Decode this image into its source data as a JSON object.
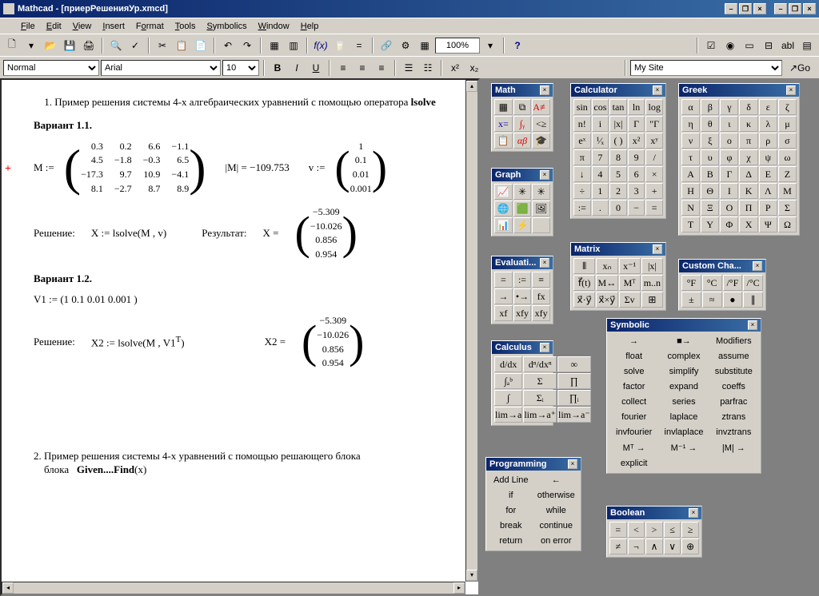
{
  "title": "Mathcad - [приерРешенияУр.xmcd]",
  "menu": [
    "File",
    "Edit",
    "View",
    "Insert",
    "Format",
    "Tools",
    "Symbolics",
    "Window",
    "Help"
  ],
  "toolbar": {
    "zoom": "100%",
    "style": "Normal",
    "font": "Arial",
    "size": "10",
    "site": "My Site",
    "go": "Go"
  },
  "doc": {
    "h1": "1.  Пример решения  системы 4-х алгебраических уравнений с помощью оператора  ",
    "lsolve": "lsolve",
    "var11": "Вариант 1.1.",
    "mlabel": "M :=",
    "m": [
      [
        "0.3",
        "0.2",
        "6.6",
        "−1.1"
      ],
      [
        "4.5",
        "−1.8",
        "−0.3",
        "6.5"
      ],
      [
        "−17.3",
        "9.7",
        "10.9",
        "−4.1"
      ],
      [
        "8.1",
        "−2.7",
        "8.7",
        "8.9"
      ]
    ],
    "det": "|M|  =  −109.753",
    "vlabel": "v :=",
    "v": [
      "1",
      "0.1",
      "0.01",
      "0.001"
    ],
    "resh": "Решение:",
    "xdef": "X := lsolve(M , v)",
    "result": "Результат:",
    "xeq": "X =",
    "X": [
      "−5.309",
      "−10.026",
      "0.856",
      "0.954"
    ],
    "var12": "Вариант 1.2.",
    "v1def": "V1 := (1   0.1   0.01   0.001 )",
    "x2def": "X2 := lsolve(M , V1",
    "t": "T",
    "x2eq": "X2 =",
    "X2": [
      "−5.309",
      "−10.026",
      "0.856",
      "0.954"
    ],
    "h2a": "2. Пример решения системы 4-х уравнений с помощью решающего блока   ",
    "h2b": "Given....Find",
    "h2c": "(x)"
  },
  "pal": {
    "math": {
      "title": "Math"
    },
    "graph": {
      "title": "Graph"
    },
    "calc": {
      "title": "Calculator",
      "rows": [
        [
          "sin",
          "cos",
          "tan",
          "ln",
          "log"
        ],
        [
          "n!",
          "i",
          "|x|",
          "Γ",
          "\"Γ"
        ],
        [
          "eˣ",
          "¹⁄ₓ",
          "( )",
          "x²",
          "xʸ"
        ],
        [
          "π",
          "7",
          "8",
          "9",
          "/"
        ],
        [
          "↓",
          "4",
          "5",
          "6",
          "×"
        ],
        [
          "÷",
          "1",
          "2",
          "3",
          "+"
        ],
        [
          ":=",
          ".",
          "0",
          "−",
          "="
        ]
      ]
    },
    "greek": {
      "title": "Greek",
      "rows": [
        [
          "α",
          "β",
          "γ",
          "δ",
          "ε",
          "ζ"
        ],
        [
          "η",
          "θ",
          "ι",
          "κ",
          "λ",
          "μ"
        ],
        [
          "ν",
          "ξ",
          "ο",
          "π",
          "ρ",
          "σ"
        ],
        [
          "τ",
          "υ",
          "φ",
          "χ",
          "ψ",
          "ω"
        ],
        [
          "Α",
          "Β",
          "Γ",
          "Δ",
          "Ε",
          "Ζ"
        ],
        [
          "Η",
          "Θ",
          "Ι",
          "Κ",
          "Λ",
          "Μ"
        ],
        [
          "Ν",
          "Ξ",
          "Ο",
          "Π",
          "Ρ",
          "Σ"
        ],
        [
          "Τ",
          "Υ",
          "Φ",
          "Χ",
          "Ψ",
          "Ω"
        ]
      ]
    },
    "matrix": {
      "title": "Matrix",
      "rows": [
        [
          "⦀",
          "xₙ",
          "x⁻¹",
          "|x|"
        ],
        [
          "f⃗(t)",
          "M↔",
          "Mᵀ",
          "m..n"
        ],
        [
          "x⃗·y⃗",
          "x⃗×y⃗",
          "Σv",
          "⊞"
        ]
      ]
    },
    "eval": {
      "title": "Evaluati...",
      "rows": [
        [
          "=",
          ":=",
          "≡"
        ],
        [
          "→",
          "•→",
          "fx"
        ],
        [
          "xf",
          "xfy",
          "xfy"
        ]
      ]
    },
    "calculus": {
      "title": "Calculus",
      "rows": [
        [
          "d/dx",
          "dⁿ/dxⁿ",
          "∞"
        ],
        [
          "∫ₐᵇ",
          "Σ",
          "∏"
        ],
        [
          "∫",
          "Σᵢ",
          "∏ᵢ"
        ],
        [
          "lim→a",
          "lim→a⁺",
          "lim→a⁻"
        ]
      ]
    },
    "custom": {
      "title": "Custom Cha...",
      "rows": [
        [
          "°F",
          "°C",
          "/°F",
          "/°C"
        ],
        [
          "±",
          "≈",
          "●",
          "∥"
        ]
      ]
    },
    "symbolic": {
      "title": "Symbolic",
      "rows": [
        [
          "→",
          "■→",
          "Modifiers"
        ],
        [
          "float",
          "complex",
          "assume"
        ],
        [
          "solve",
          "simplify",
          "substitute"
        ],
        [
          "factor",
          "expand",
          "coeffs"
        ],
        [
          "collect",
          "series",
          "parfrac"
        ],
        [
          "fourier",
          "laplace",
          "ztrans"
        ],
        [
          "invfourier",
          "invlaplace",
          "invztrans"
        ],
        [
          "Mᵀ →",
          "M⁻¹ →",
          "|M| →"
        ],
        [
          "explicit",
          "",
          ""
        ]
      ]
    },
    "prog": {
      "title": "Programming",
      "rows": [
        [
          "Add Line",
          "←"
        ],
        [
          "if",
          "otherwise"
        ],
        [
          "for",
          "while"
        ],
        [
          "break",
          "continue"
        ],
        [
          "return",
          "on error"
        ]
      ]
    },
    "bool": {
      "title": "Boolean",
      "rows": [
        [
          "=",
          "<",
          ">",
          "≤",
          "≥"
        ],
        [
          "≠",
          "¬",
          "∧",
          "∨",
          "⊕"
        ]
      ]
    }
  }
}
